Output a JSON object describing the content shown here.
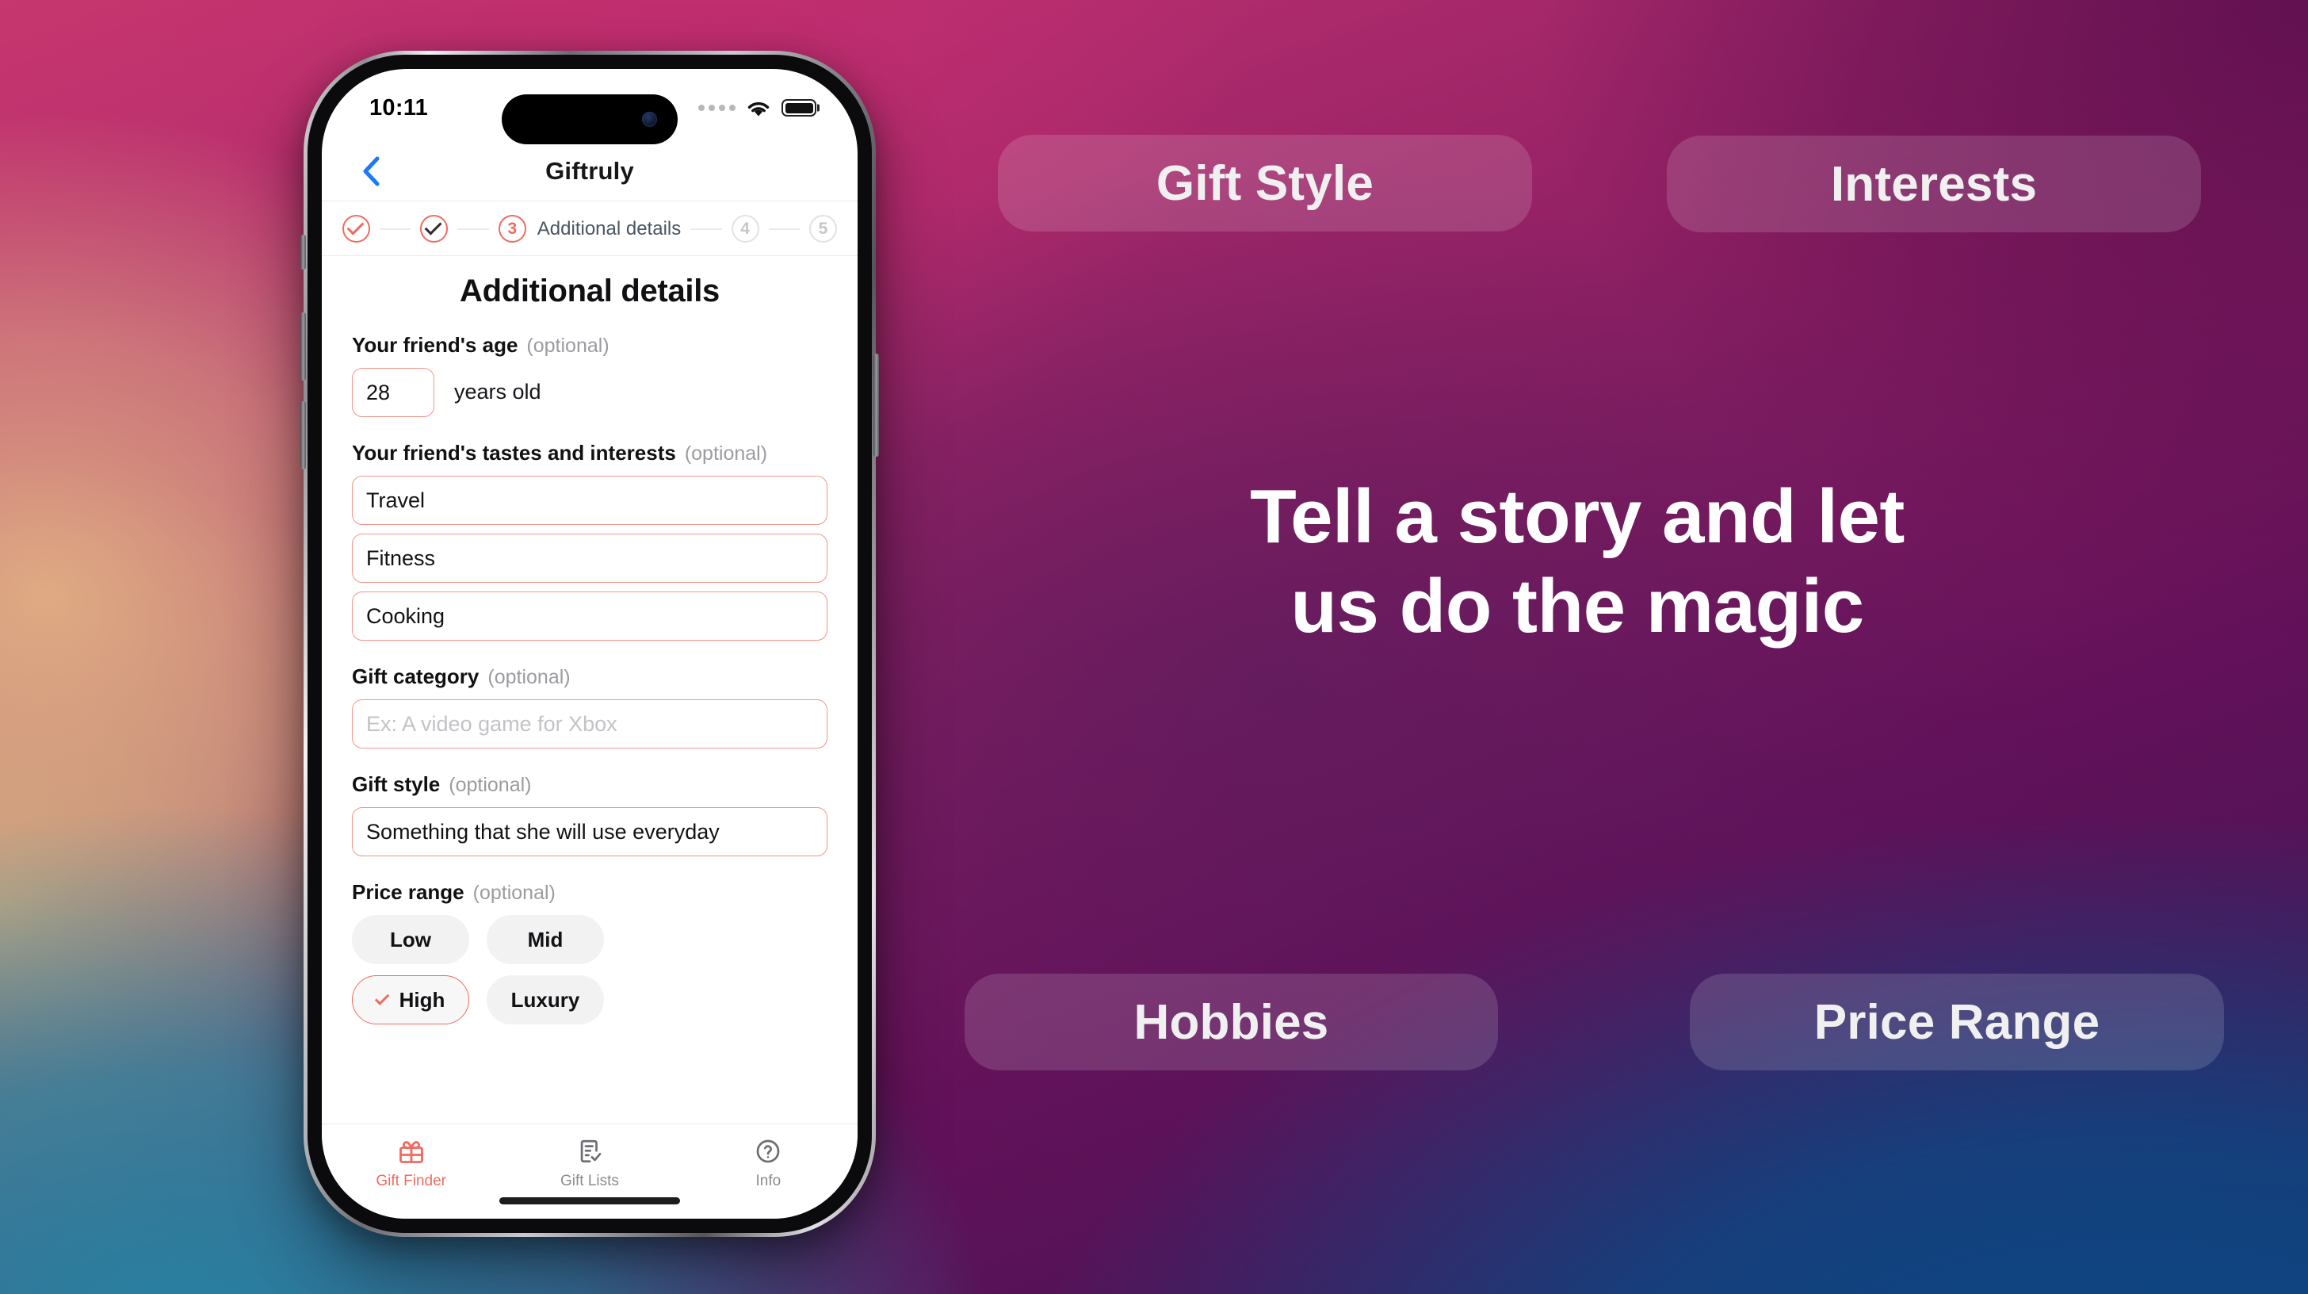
{
  "promo": {
    "pills": [
      {
        "id": "gift-style",
        "label": "Gift Style"
      },
      {
        "id": "interests",
        "label": "Interests"
      },
      {
        "id": "hobbies",
        "label": "Hobbies"
      },
      {
        "id": "price-range",
        "label": "Price Range"
      }
    ],
    "headline_line1": "Tell a story and let",
    "headline_line2": "us do the magic",
    "pill_bg": "#ffffff24",
    "headline_color": "#ffffff"
  },
  "background": {
    "top_left": "#c7366e",
    "top_right": "#5c1050",
    "bottom_left": "#2684a3",
    "bottom_right": "#094a86",
    "mid_left_warm": "#c9a98a"
  },
  "phone": {
    "status": {
      "time": "10:11",
      "signal_icon": "signal-dots-icon",
      "wifi_icon": "wifi-icon",
      "battery_icon": "battery-full-icon"
    },
    "nav": {
      "back_icon": "chevron-left-icon",
      "title": "Giftruly"
    },
    "stepper": {
      "steps": [
        {
          "id": "1",
          "display": "check",
          "label": "",
          "state": "done-accent"
        },
        {
          "id": "2",
          "display": "check",
          "label": "",
          "state": "done-dark"
        },
        {
          "id": "3",
          "display": "3",
          "label": "Additional details",
          "state": "current"
        },
        {
          "id": "4",
          "display": "4",
          "label": "",
          "state": "upcoming"
        },
        {
          "id": "5",
          "display": "5",
          "label": "",
          "state": "upcoming"
        }
      ],
      "accent": "#ef6b5f",
      "muted": "#c7c7cb"
    },
    "page_title": "Additional details",
    "optional_tag": "(optional)",
    "fields": {
      "age": {
        "label": "Your friend's age",
        "value": "28",
        "suffix": "years old"
      },
      "tastes": {
        "label": "Your friend's tastes and interests",
        "values": [
          "Travel",
          "Fitness",
          "Cooking"
        ]
      },
      "category": {
        "label": "Gift category",
        "value": "",
        "placeholder": "Ex: A video game for Xbox"
      },
      "style": {
        "label": "Gift style",
        "value": "Something that she will use everyday"
      },
      "price_range": {
        "label": "Price range",
        "options": [
          {
            "label": "Low",
            "selected": false
          },
          {
            "label": "Mid",
            "selected": false
          },
          {
            "label": "High",
            "selected": true
          },
          {
            "label": "Luxury",
            "selected": false
          }
        ]
      }
    },
    "tabbar": {
      "tabs": [
        {
          "label": "Gift Finder",
          "icon": "gift-icon",
          "active": true
        },
        {
          "label": "Gift Lists",
          "icon": "list-check-icon",
          "active": false
        },
        {
          "label": "Info",
          "icon": "question-circle-icon",
          "active": false
        }
      ]
    },
    "accent_color": "#ef6b5f",
    "link_color": "#1a7af8"
  }
}
